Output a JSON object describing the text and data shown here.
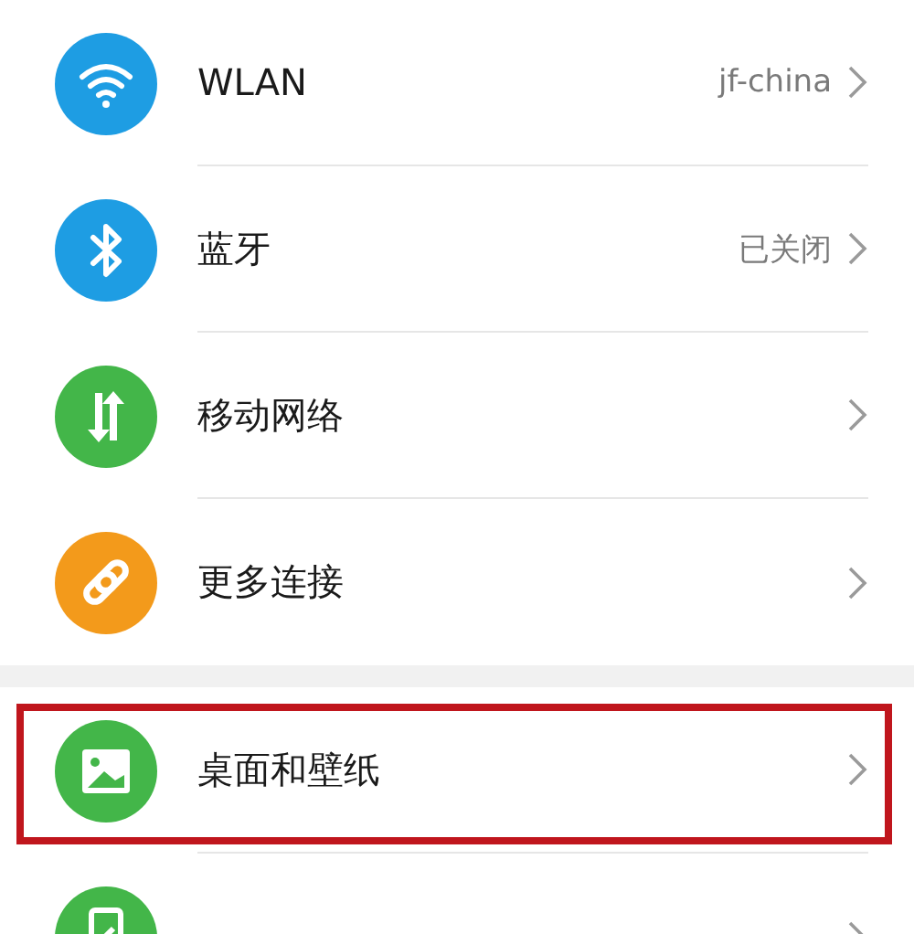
{
  "groups": [
    {
      "items": [
        {
          "kind": "wifi",
          "color": "#1e9de3",
          "label": "WLAN",
          "value": "jf-china",
          "highlighted": false
        },
        {
          "kind": "bluetooth",
          "color": "#1e9de3",
          "label": "蓝牙",
          "value": "已关闭",
          "highlighted": false
        },
        {
          "kind": "mobile-data",
          "color": "#43b649",
          "label": "移动网络",
          "highlighted": false
        },
        {
          "kind": "link",
          "color": "#f39a1b",
          "label": "更多连接",
          "highlighted": false
        }
      ]
    },
    {
      "items": [
        {
          "kind": "image",
          "color": "#43b649",
          "label": "桌面和壁纸",
          "highlighted": true
        },
        {
          "kind": "phone",
          "color": "#43b649",
          "highlighted": false
        }
      ]
    }
  ]
}
